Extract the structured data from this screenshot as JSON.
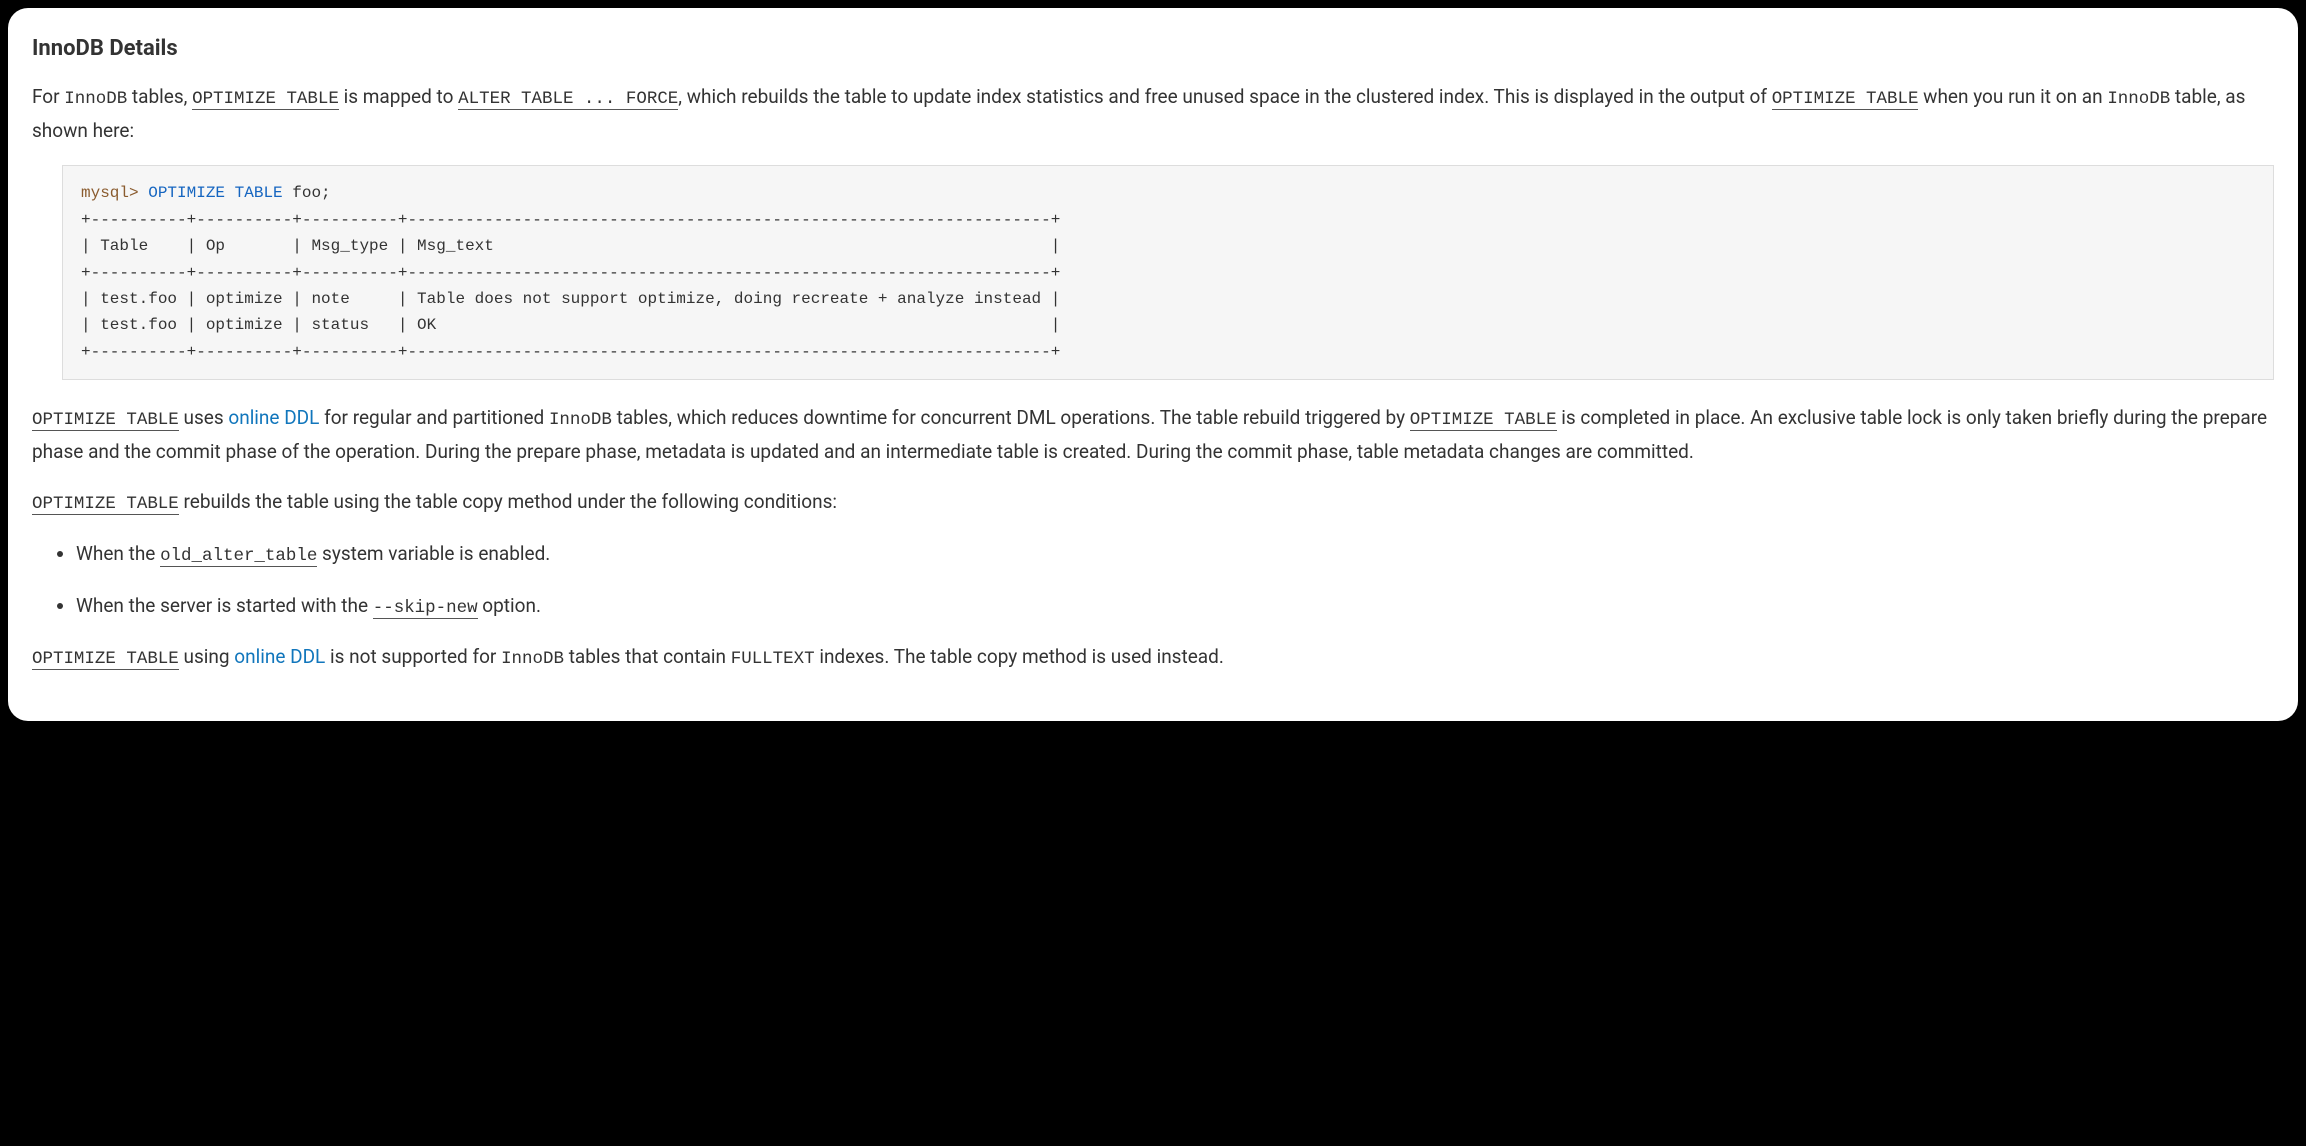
{
  "heading": "InnoDB Details",
  "p1": {
    "t1": "For ",
    "c1": "InnoDB",
    "t2": " tables, ",
    "c2": "OPTIMIZE TABLE",
    "t3": " is mapped to ",
    "c3": "ALTER TABLE ... FORCE",
    "t4": ", which rebuilds the table to update index statistics and free unused space in the clustered index. This is displayed in the output of ",
    "c4": "OPTIMIZE TABLE",
    "t5": " when you run it on an ",
    "c5": "InnoDB",
    "t6": " table, as shown here:"
  },
  "code": {
    "prompt": "mysql>",
    "kw": "OPTIMIZE TABLE",
    "arg": " foo",
    "semi": ";",
    "body": "+----------+----------+----------+-------------------------------------------------------------------+\n| Table    | Op       | Msg_type | Msg_text                                                          |\n+----------+----------+----------+-------------------------------------------------------------------+\n| test.foo | optimize | note     | Table does not support optimize, doing recreate + analyze instead |\n| test.foo | optimize | status   | OK                                                                |\n+----------+----------+----------+-------------------------------------------------------------------+"
  },
  "p2": {
    "c1": "OPTIMIZE TABLE",
    "t1": " uses ",
    "a1": "online DDL",
    "t2": " for regular and partitioned ",
    "c2": "InnoDB",
    "t3": " tables, which reduces downtime for concurrent DML operations. The table rebuild triggered by ",
    "c3": "OPTIMIZE TABLE",
    "t4": " is completed in place. An exclusive table lock is only taken briefly during the prepare phase and the commit phase of the operation. During the prepare phase, metadata is updated and an intermediate table is created. During the commit phase, table metadata changes are committed."
  },
  "p3": {
    "c1": "OPTIMIZE TABLE",
    "t1": " rebuilds the table using the table copy method under the following conditions:"
  },
  "bullets": {
    "b1": {
      "t1": "When the ",
      "c1": "old_alter_table",
      "t2": " system variable is enabled."
    },
    "b2": {
      "t1": "When the server is started with the ",
      "c1": "--skip-new",
      "t2": " option."
    }
  },
  "p4": {
    "c1": "OPTIMIZE TABLE",
    "t1": " using ",
    "a1": "online DDL",
    "t2": " is not supported for ",
    "c2": "InnoDB",
    "t3": " tables that contain ",
    "c3": "FULLTEXT",
    "t4": " indexes. The table copy method is used instead."
  }
}
